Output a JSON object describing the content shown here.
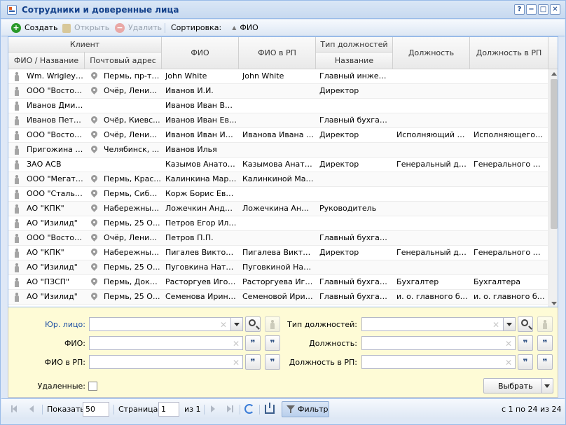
{
  "window": {
    "title": "Сотрудники и доверенные лица",
    "buttons": [
      "?",
      "−",
      "□",
      "✕"
    ]
  },
  "toolbar": {
    "create_label": "Создать",
    "open_label": "Открыть",
    "delete_label": "Удалить",
    "sort_label": "Сортировка:",
    "sort_field": "ФИО",
    "sort_arrow": "▲"
  },
  "grid": {
    "group_client": "Клиент",
    "group_position_type": "Тип должностей",
    "columns": {
      "name": "ФИО / Название",
      "address": "Почтовый адрес",
      "fio": "ФИО",
      "fio_rp": "ФИО в РП",
      "type_name": "Название",
      "position": "Должность",
      "position_rp": "Должность в РП"
    },
    "rows": [
      {
        "name": "Wm. Wrigley ...",
        "pin": true,
        "address": "Пермь, пр-т ...",
        "fio": "John White",
        "fio_rp": "John White",
        "type": "Главный инженер",
        "pos": "",
        "pos_rp": ""
      },
      {
        "name": "ООО \"Восток...",
        "pin": true,
        "address": "Очёр, Ленин...",
        "fio": "Иванов И.И.",
        "fio_rp": "",
        "type": "Директор",
        "pos": "",
        "pos_rp": ""
      },
      {
        "name": "Иванов Дмит...",
        "pin": false,
        "address": "",
        "fio": "Иванов Иван Вла...",
        "fio_rp": "",
        "type": "",
        "pos": "",
        "pos_rp": ""
      },
      {
        "name": "Иванов Петр...",
        "pin": true,
        "address": "Очёр, Киевс...",
        "fio": "Иванов Иван Евг...",
        "fio_rp": "",
        "type": "Главный бухгалт...",
        "pos": "",
        "pos_rp": ""
      },
      {
        "name": "ООО \"Восток...",
        "pin": true,
        "address": "Очёр, Ленин...",
        "fio": "Иванов Иван Ива...",
        "fio_rp": "Иванова Ивана И...",
        "type": "Директор",
        "pos": "Исполняющий об...",
        "pos_rp": "Исполняющего о..."
      },
      {
        "name": "Пригожина К...",
        "pin": true,
        "address": "Челябинск, ...",
        "fio": "Иванов Илья",
        "fio_rp": "",
        "type": "",
        "pos": "",
        "pos_rp": ""
      },
      {
        "name": "ЗАО АСВ",
        "pin": false,
        "address": "",
        "fio": "Казымов Анатол...",
        "fio_rp": "Казымова Анатол...",
        "type": "Директор",
        "pos": "Генеральный дир...",
        "pos_rp": "Генерального ди..."
      },
      {
        "name": "ООО \"Мегате...",
        "pin": true,
        "address": "Пермь, Крас...",
        "fio": "Калинкина Мари...",
        "fio_rp": "Калинкиной Мар...",
        "type": "",
        "pos": "",
        "pos_rp": ""
      },
      {
        "name": "ООО \"Стальп...",
        "pin": true,
        "address": "Пермь, Сиби...",
        "fio": "Корж Борис Евге...",
        "fio_rp": "",
        "type": "",
        "pos": "",
        "pos_rp": ""
      },
      {
        "name": "АО \"КПК\"",
        "pin": true,
        "address": "Набережные...",
        "fio": "Ложечкин Андрей",
        "fio_rp": "Ложечкина Андрея",
        "type": "Руководитель",
        "pos": "",
        "pos_rp": ""
      },
      {
        "name": "АО \"Изилид\"",
        "pin": true,
        "address": "Пермь, 25 О...",
        "fio": "Петров Егор Ильич",
        "fio_rp": "",
        "type": "",
        "pos": "",
        "pos_rp": ""
      },
      {
        "name": "ООО \"Восток...",
        "pin": true,
        "address": "Очёр, Ленин...",
        "fio": "Петров П.П.",
        "fio_rp": "",
        "type": "Главный бухгалт...",
        "pos": "",
        "pos_rp": ""
      },
      {
        "name": "АО \"КПК\"",
        "pin": true,
        "address": "Набережные...",
        "fio": "Пигалев Виктор ...",
        "fio_rp": "Пигалева Виктор...",
        "type": "Директор",
        "pos": "Генеральный дир...",
        "pos_rp": "Генерального ди..."
      },
      {
        "name": "АО \"Изилид\"",
        "pin": true,
        "address": "Пермь, 25 О...",
        "fio": "Пуговкина Наталья",
        "fio_rp": "Пуговкиной Ната...",
        "type": "",
        "pos": "",
        "pos_rp": ""
      },
      {
        "name": "АО \"ПЗСП\"",
        "pin": true,
        "address": "Пермь, Доку...",
        "fio": "Расторгуев Игорь...",
        "fio_rp": "Расторгуева Игор...",
        "type": "Главный бухгалт...",
        "pos": "Бухгалтер",
        "pos_rp": "Бухгалтера"
      },
      {
        "name": "АО \"Изилид\"",
        "pin": true,
        "address": "Пермь, 25 О...",
        "fio": "Семенова Ирина ...",
        "fio_rp": "Семеновой Ирин...",
        "type": "Главный бухгалт...",
        "pos": "и. о. главного бу...",
        "pos_rp": "и. о. главного бу..."
      }
    ]
  },
  "filter": {
    "legal_entity_label": "Юр. лицо:",
    "fio_label": "ФИО:",
    "fio_rp_label": "ФИО в РП:",
    "position_type_label": "Тип должностей:",
    "position_label": "Должность:",
    "position_rp_label": "Должность в РП:",
    "deleted_label": "Удаленные:",
    "select_label": "Выбрать",
    "clear_glyph": "✕",
    "quote_glyph": "❞"
  },
  "pager": {
    "show_label": "Показать",
    "page_size": "50",
    "page_label": "Страница",
    "page_value": "1",
    "of_label": "из 1",
    "filter_label": "Фильтр",
    "summary": "с 1 по 24 из 24"
  },
  "colors": {
    "accent": "#15428b",
    "link": "#1e4fa3",
    "filter_bg": "#fefbd6",
    "create_green": "#2a9a2a",
    "delete_red": "#d9534f"
  },
  "icons": [
    "app-icon",
    "create-icon",
    "open-icon",
    "delete-icon",
    "sort-asc-icon",
    "person-icon",
    "pin-icon",
    "search-icon",
    "person-lookup-icon",
    "quote-icon",
    "refresh-icon",
    "export-icon",
    "filter-icon"
  ]
}
